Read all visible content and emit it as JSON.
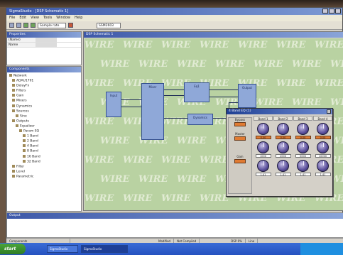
{
  "window": {
    "title": "SigmaStudio - [DSP Schematic 1]"
  },
  "menu": [
    "File",
    "Edit",
    "View",
    "Tools",
    "Window",
    "Help"
  ],
  "toolbar": {
    "select_value": "SSM2603",
    "dropdown_value": "Sample rate"
  },
  "properties_panel": {
    "title": "Properties",
    "rows": [
      {
        "key": "(Name)",
        "value": ""
      },
      {
        "key": "Name",
        "value": ""
      }
    ]
  },
  "components_panel": {
    "title": "Components",
    "tree": [
      {
        "level": 0,
        "label": "Network"
      },
      {
        "level": 1,
        "label": "ADAU1701"
      },
      {
        "level": 1,
        "label": "DelayFx"
      },
      {
        "level": 1,
        "label": "Filters"
      },
      {
        "level": 1,
        "label": "Gain"
      },
      {
        "level": 1,
        "label": "Mixers"
      },
      {
        "level": 1,
        "label": "Dynamics"
      },
      {
        "level": 1,
        "label": "Sources"
      },
      {
        "level": 2,
        "label": "Sine"
      },
      {
        "level": 1,
        "label": "Outputs"
      },
      {
        "level": 2,
        "label": "Equalizer"
      },
      {
        "level": 3,
        "label": "Param EQ"
      },
      {
        "level": 4,
        "label": "1 Band"
      },
      {
        "level": 4,
        "label": "2 Band"
      },
      {
        "level": 4,
        "label": "4 Band"
      },
      {
        "level": 4,
        "label": "8 Band"
      },
      {
        "level": 4,
        "label": "16 Band"
      },
      {
        "level": 4,
        "label": "32 Band"
      },
      {
        "level": 1,
        "label": "Filter"
      },
      {
        "level": 1,
        "label": "Level"
      },
      {
        "level": 1,
        "label": "Parametric"
      }
    ]
  },
  "schematic": {
    "title": "DSP Schematic 1",
    "watermark": "WIRE",
    "blocks": [
      {
        "id": "input",
        "label": "Input"
      },
      {
        "id": "mixer",
        "label": "Mixer"
      },
      {
        "id": "eq",
        "label": "Eq1"
      },
      {
        "id": "dyn",
        "label": "Dynamics"
      },
      {
        "id": "out",
        "label": "Output"
      }
    ]
  },
  "eq_dialog": {
    "title": "4 Band EQ (1)",
    "left": {
      "bypass_label": "Bypass",
      "master_label": "Master",
      "gain_label": "Gain"
    },
    "bands": [
      {
        "name": "Band 1",
        "values": [
          "0.00",
          "1000",
          "1.41"
        ]
      },
      {
        "name": "Band 2",
        "values": [
          "0.00",
          "2000",
          "1.41"
        ]
      },
      {
        "name": "Band 3",
        "values": [
          "0.00",
          "5000",
          "1.41"
        ]
      },
      {
        "name": "Band 4",
        "values": [
          "0.00",
          "10000",
          "1.41"
        ]
      }
    ],
    "row_labels": [
      "Boost/Cut",
      "Center Freq",
      "Q"
    ]
  },
  "output_panel": {
    "title": "Output"
  },
  "statusbar": [
    "Components",
    "Modified",
    "Not Compiled",
    "DSP 0%",
    "Line"
  ],
  "taskbar": {
    "start": "start",
    "tasks": [
      "SigmaStudio",
      "SigmaStudio"
    ],
    "clock": ""
  },
  "colors": {
    "canvas": "#b9d2a2",
    "title": "#3d58a8",
    "block": "#8fa8d8",
    "accent": "#e07b33"
  }
}
